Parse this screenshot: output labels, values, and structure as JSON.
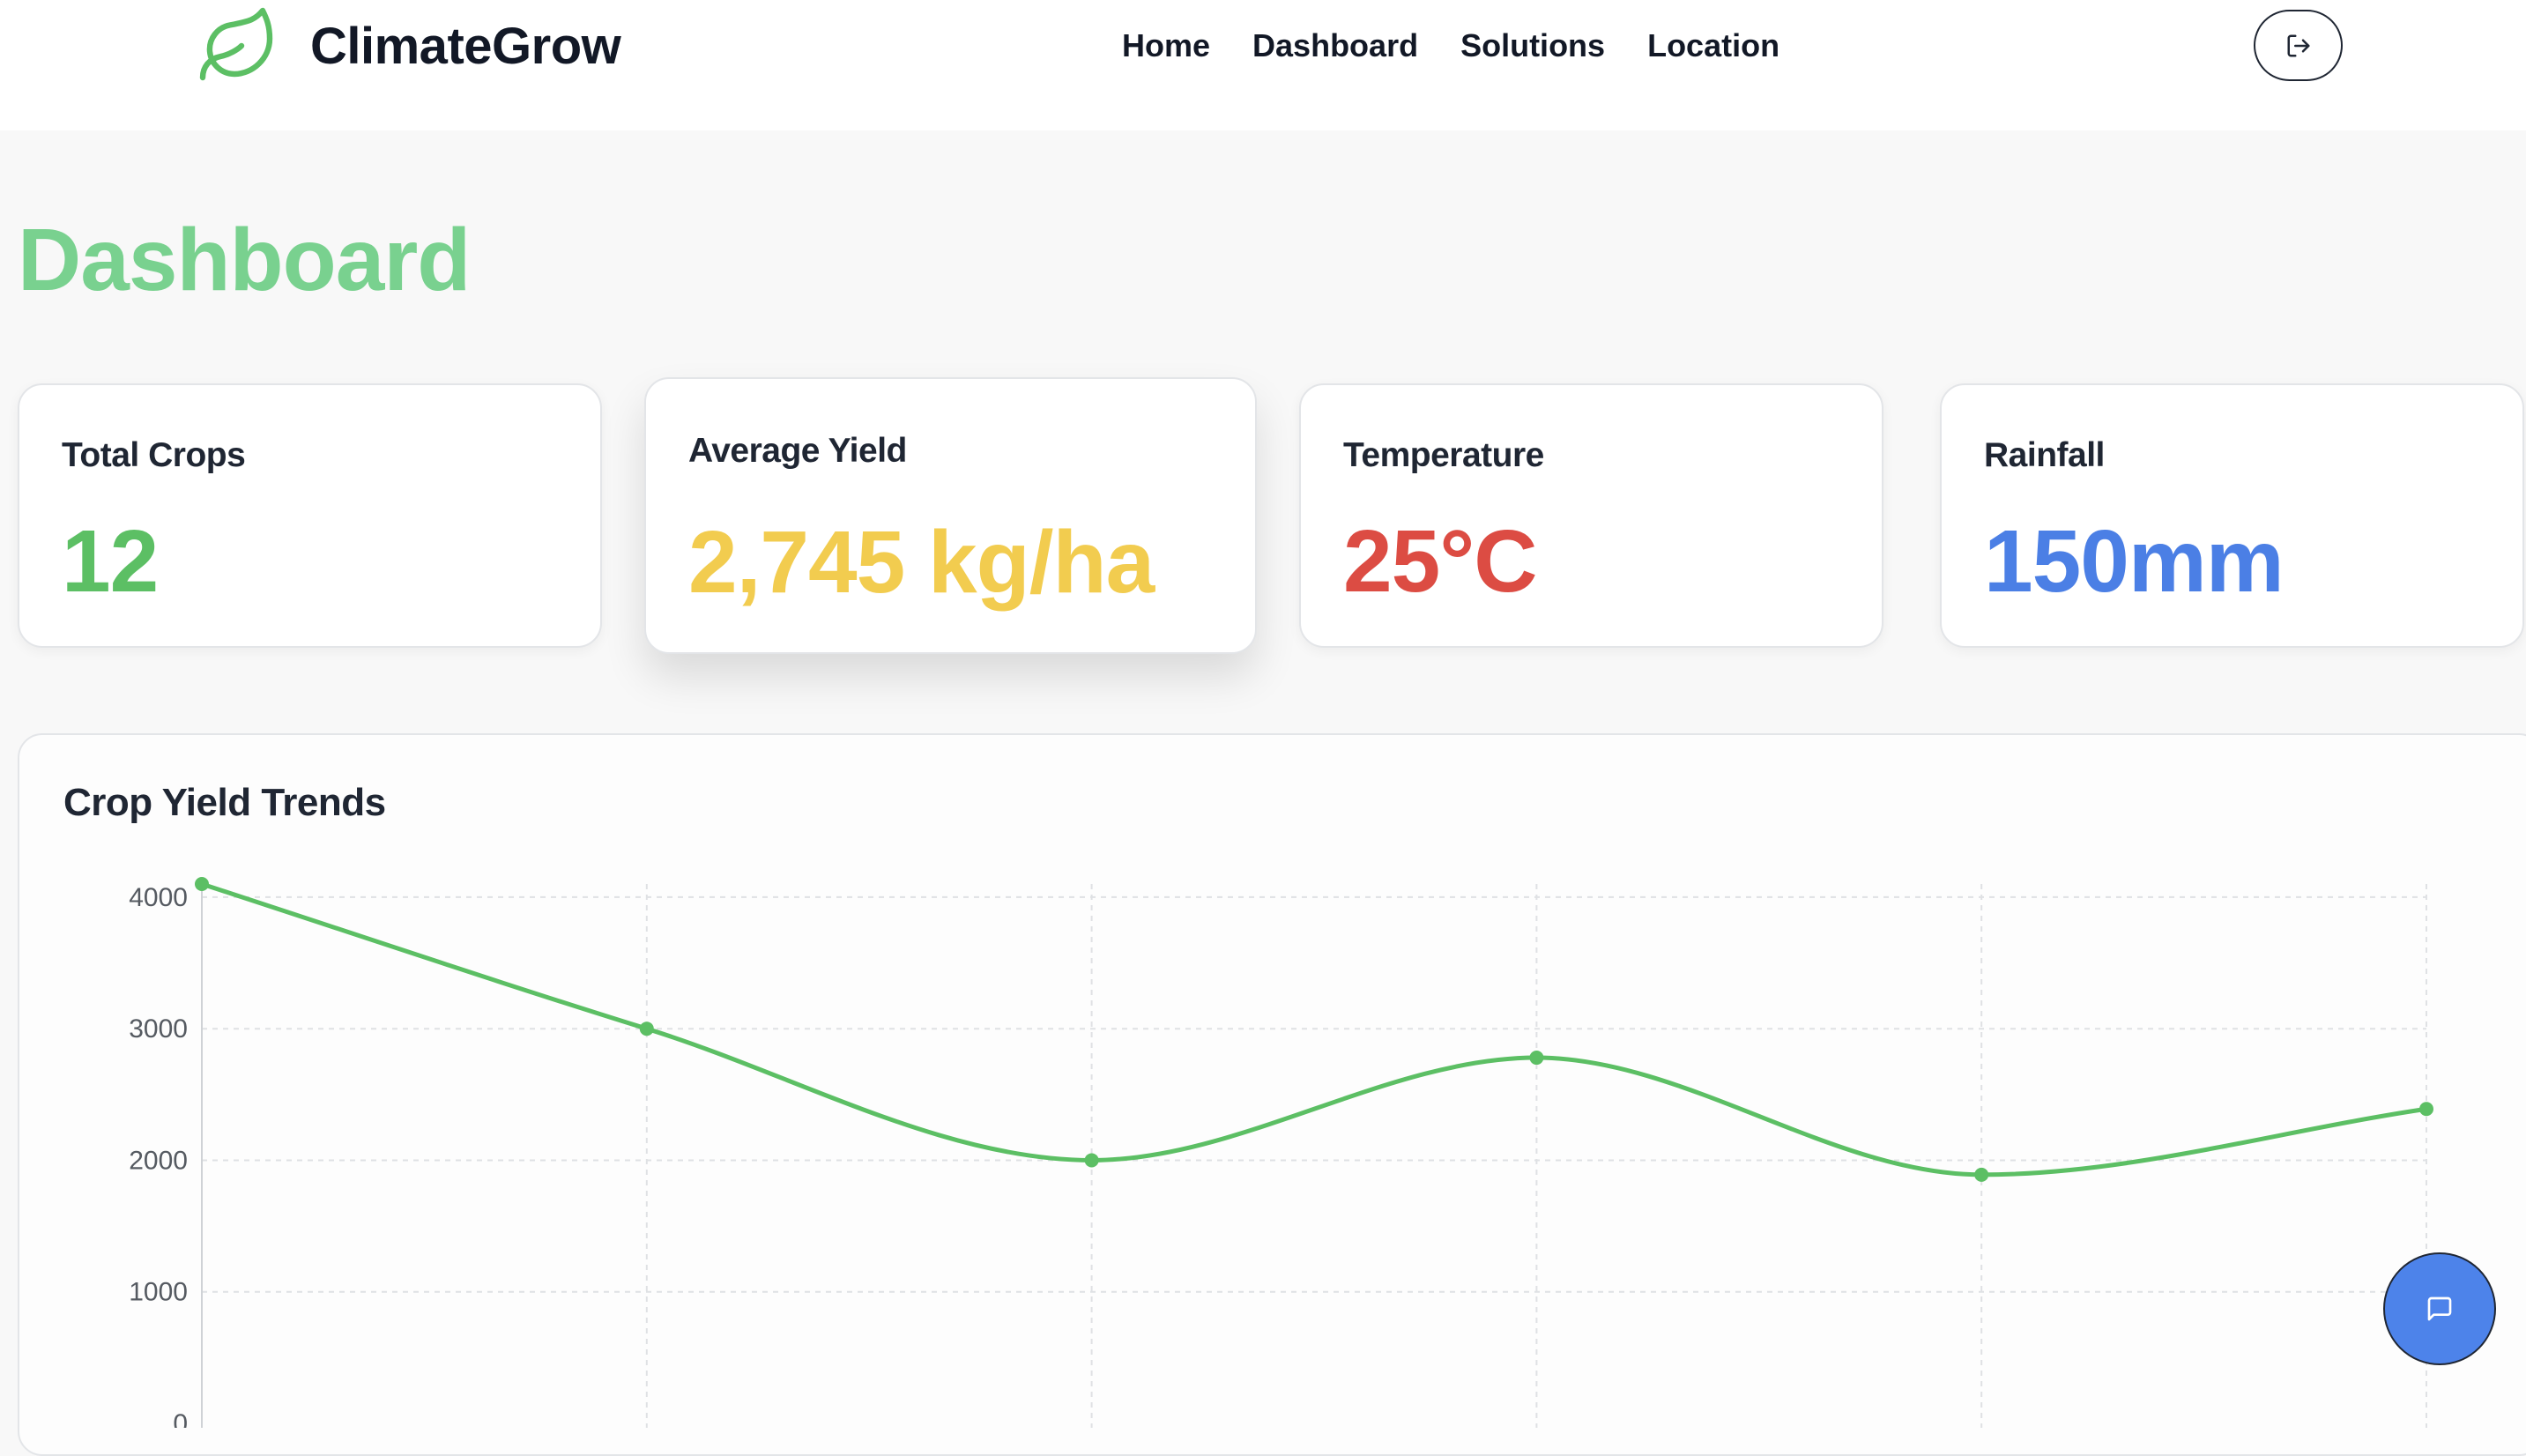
{
  "brand": {
    "name": "ClimateGrow",
    "icon": "leaf-icon"
  },
  "nav": {
    "items": [
      {
        "label": "Home"
      },
      {
        "label": "Dashboard"
      },
      {
        "label": "Solutions"
      },
      {
        "label": "Location"
      }
    ],
    "logout_icon": "logout-icon"
  },
  "page": {
    "title": "Dashboard"
  },
  "stats": [
    {
      "label": "Total Crops",
      "value": "12",
      "color": "#5cbf64"
    },
    {
      "label": "Average Yield",
      "value": "2,745 kg/ha",
      "color": "#f2cc4f"
    },
    {
      "label": "Temperature",
      "value": "25°C",
      "color": "#dc4c43"
    },
    {
      "label": "Rainfall",
      "value": "150mm",
      "color": "#4b7fe5"
    }
  ],
  "chart": {
    "title": "Crop Yield Trends"
  },
  "chart_data": {
    "type": "line",
    "x": [
      0,
      1,
      2,
      3,
      4,
      5
    ],
    "series": [
      {
        "values": [
          4100,
          3000,
          2000,
          2780,
          1890,
          2390
        ]
      }
    ],
    "y_ticks": [
      "0",
      "1000",
      "2000",
      "3000",
      "4000"
    ],
    "ylim": [
      0,
      4100
    ],
    "grid": true,
    "line_color": "#5cbf64",
    "smooth": true
  },
  "chat": {
    "icon": "chat-bubble-icon"
  }
}
